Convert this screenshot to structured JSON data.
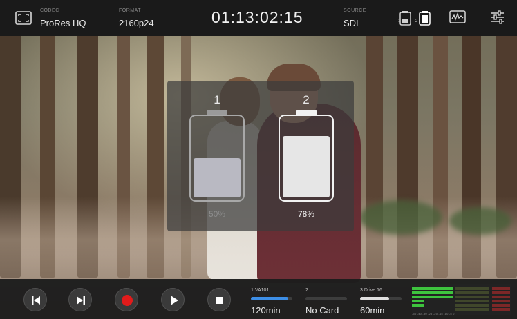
{
  "topbar": {
    "codec_label": "CODEC",
    "codec_value": "ProRes HQ",
    "format_label": "FORMAT",
    "format_value": "2160p24",
    "timecode": "01:13:02:15",
    "source_label": "SOURCE",
    "source_value": "SDI",
    "battery_slot_1": "1",
    "battery_slot_2": "2"
  },
  "battery_overlay": {
    "batteries": [
      {
        "label": "1",
        "percent_text": "50%",
        "level": 0.5,
        "active": false
      },
      {
        "label": "2",
        "percent_text": "78%",
        "level": 0.78,
        "active": true
      }
    ]
  },
  "transport": {
    "buttons": [
      "skip-back",
      "skip-forward",
      "record",
      "play",
      "stop"
    ]
  },
  "media_slots": [
    {
      "label": "1  VA101",
      "remaining": "120min",
      "fill": 0.9,
      "color": "#3d8ee6"
    },
    {
      "label": "2",
      "remaining": "No Card",
      "fill": 0.0,
      "color": "#3d3d3d"
    },
    {
      "label": "3  Drive 16",
      "remaining": "60min",
      "fill": 0.7,
      "color": "#e0e0e0"
    }
  ],
  "audio_meter": {
    "scale": "-50 -40   -30 -25 -20   -15   -10   -5   0"
  },
  "colors": {
    "record": "#e21b1b",
    "meter_green": "#3ec33e",
    "meter_red": "#c62c2c",
    "accent_blue": "#3d8ee6"
  }
}
